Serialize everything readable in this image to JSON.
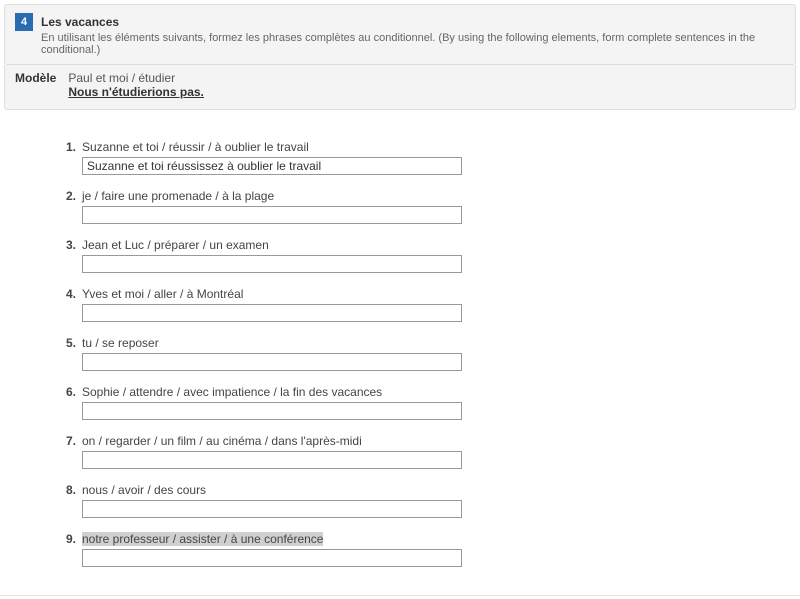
{
  "header": {
    "number": "4",
    "title": "Les vacances",
    "instructions": "En utilisant les éléments suivants, formez les phrases complètes au conditionnel. (By using the following elements, form complete sentences in the conditional.)"
  },
  "modele": {
    "label": "Modèle",
    "prompt": "Paul et moi / étudier",
    "answer": "Nous n'étudierions pas."
  },
  "questions": [
    {
      "num": "1.",
      "prompt": "Suzanne et toi / réussir / à oublier le travail",
      "value": "Suzanne et toi réussissez à oublier le travail",
      "highlight": false
    },
    {
      "num": "2.",
      "prompt": "je / faire une promenade / à la plage",
      "value": "",
      "highlight": false
    },
    {
      "num": "3.",
      "prompt": "Jean et Luc / préparer / un examen",
      "value": "",
      "highlight": false
    },
    {
      "num": "4.",
      "prompt": "Yves et moi / aller / à Montréal",
      "value": "",
      "highlight": false
    },
    {
      "num": "5.",
      "prompt": "tu / se reposer",
      "value": "",
      "highlight": false
    },
    {
      "num": "6.",
      "prompt": "Sophie / attendre / avec impatience / la fin des vacances",
      "value": "",
      "highlight": false
    },
    {
      "num": "7.",
      "prompt": "on / regarder / un film / au cinéma / dans l'après-midi",
      "value": "",
      "highlight": false
    },
    {
      "num": "8.",
      "prompt": "nous / avoir / des cours",
      "value": "",
      "highlight": false
    },
    {
      "num": "9.",
      "prompt": "notre professeur / assister / à une conférence",
      "value": "",
      "highlight": true
    }
  ]
}
